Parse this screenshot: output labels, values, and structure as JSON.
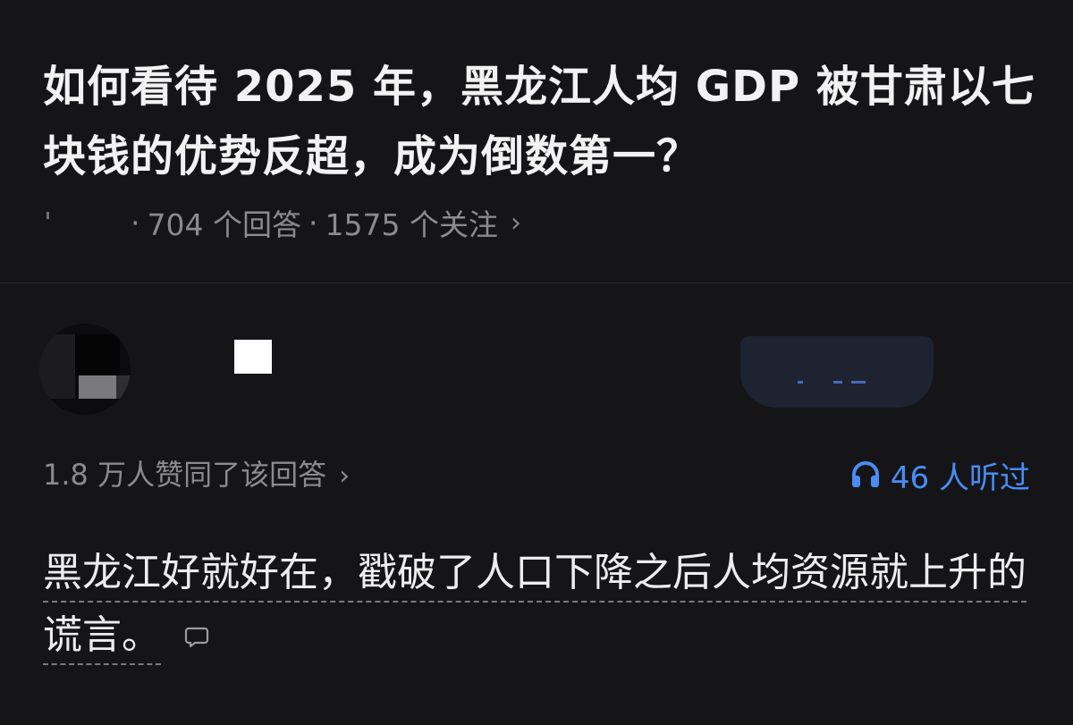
{
  "question": {
    "title": "如何看待 2025 年，黑龙江人均 GDP 被甘肃以七块钱的优势反超，成为倒数第一？",
    "answer_count": "704 个回答",
    "follower_count": "1575 个关注",
    "separator": "·",
    "chevron": "›"
  },
  "answer": {
    "votes_text": "1.8 万人赞同了该回答",
    "listen_count": "46 人听过",
    "listen_icon": "headphone-icon",
    "body": "黑龙江好就好在，戳破了人口下降之后人均资源就上升的谎言。",
    "comment_icon": "comment-bubble-icon"
  },
  "colors": {
    "background": "#151518",
    "text": "#ECECEC",
    "muted": "#8A8A8F",
    "accent_blue": "#4A8CF7",
    "divider": "#2A2A2E"
  }
}
